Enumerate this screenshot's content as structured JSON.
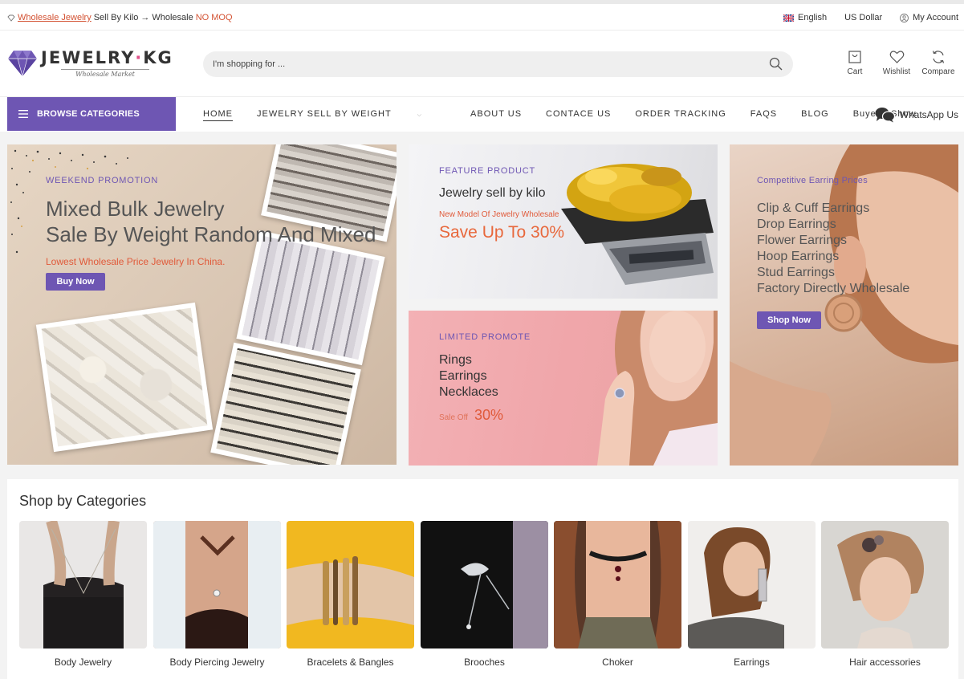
{
  "topbar": {
    "wholesale_link": "Wholesale Jewelry",
    "sell_text": "Sell By Kilo",
    "arrow": "→",
    "wholesale_text": "Wholesale",
    "no_moq": "NO MOQ",
    "language": "English",
    "currency": "US Dollar",
    "account": "My Account"
  },
  "header": {
    "logo_main": "JEWELRY",
    "logo_dot": "·",
    "logo_kg": "KG",
    "logo_sub": "Wholesale Market",
    "search_placeholder": "I'm shopping for ...",
    "cart": "Cart",
    "wishlist": "Wishlist",
    "compare": "Compare"
  },
  "nav": {
    "browse": "BROWSE CATEGORIES",
    "links": [
      "HOME",
      "JEWELRY SELL BY WEIGHT",
      "ABOUT US",
      "CONTACE US",
      "ORDER TRACKING",
      "FAQS",
      "BLOG",
      "Buyer's Show"
    ],
    "whatsapp": "WhatsApp Us"
  },
  "banners": {
    "weekend": {
      "tag": "WEEKEND PROMOTION",
      "line1": "Mixed Bulk Jewelry",
      "line2": "Sale By Weight Random And Mixed",
      "sub": "Lowest Wholesale Price Jewelry In China.",
      "button": "Buy Now"
    },
    "feature": {
      "tag": "FEATURE PRODUCT",
      "title": "Jewelry sell by kilo",
      "small": "New Model Of Jewelry Wholesale",
      "save": "Save Up To 30%"
    },
    "limited": {
      "tag": "LIMITED PROMOTE",
      "items": [
        "Rings",
        "Earrings",
        "Necklaces"
      ],
      "off_label": "Sale Off",
      "off_pct": "30%"
    },
    "earring": {
      "tag": "Competitive Earring Prices",
      "items": [
        "Clip & Cuff Earrings",
        "Drop Earrings",
        "Flower Earrings",
        "Hoop Earrings",
        "Stud Earrings",
        "Factory Directly Wholesale"
      ],
      "button": "Shop Now"
    }
  },
  "categories": {
    "title": "Shop by Categories",
    "items": [
      "Body Jewelry",
      "Body Piercing Jewelry",
      "Bracelets & Bangles",
      "Brooches",
      "Choker",
      "Earrings",
      "Hair accessories"
    ]
  },
  "colors": {
    "accent": "#6e56b3",
    "highlight": "#e05a3a"
  }
}
